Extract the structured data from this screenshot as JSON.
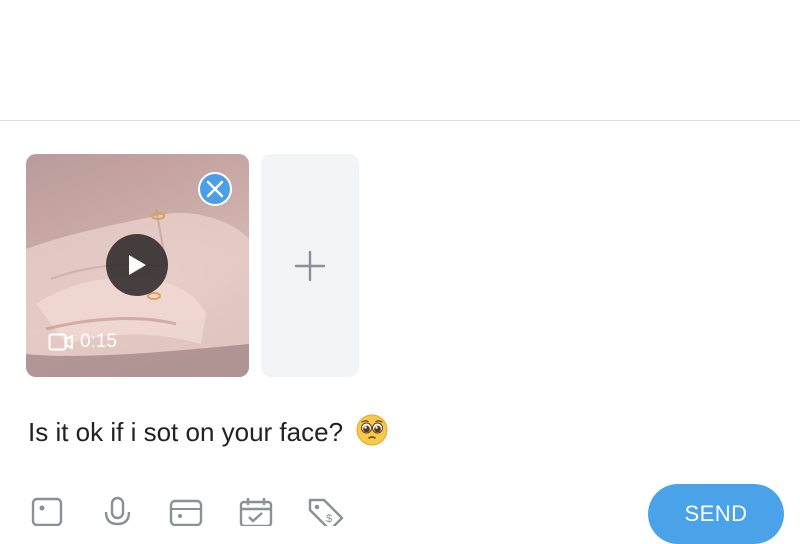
{
  "attachment": {
    "duration": "0:15"
  },
  "composer": {
    "message_text": "Is it ok if i sot on your face?",
    "emoji": "pleading-face"
  },
  "toolbar": {
    "icons": [
      "image-icon",
      "microphone-icon",
      "gif-icon",
      "calendar-icon",
      "price-tag-icon"
    ],
    "send_label": "SEND"
  },
  "colors": {
    "accent": "#4aa3e8",
    "remove_button": "#4c9fe6",
    "add_tile": "#f3f4f6",
    "icon_gray": "#8a8f98"
  }
}
